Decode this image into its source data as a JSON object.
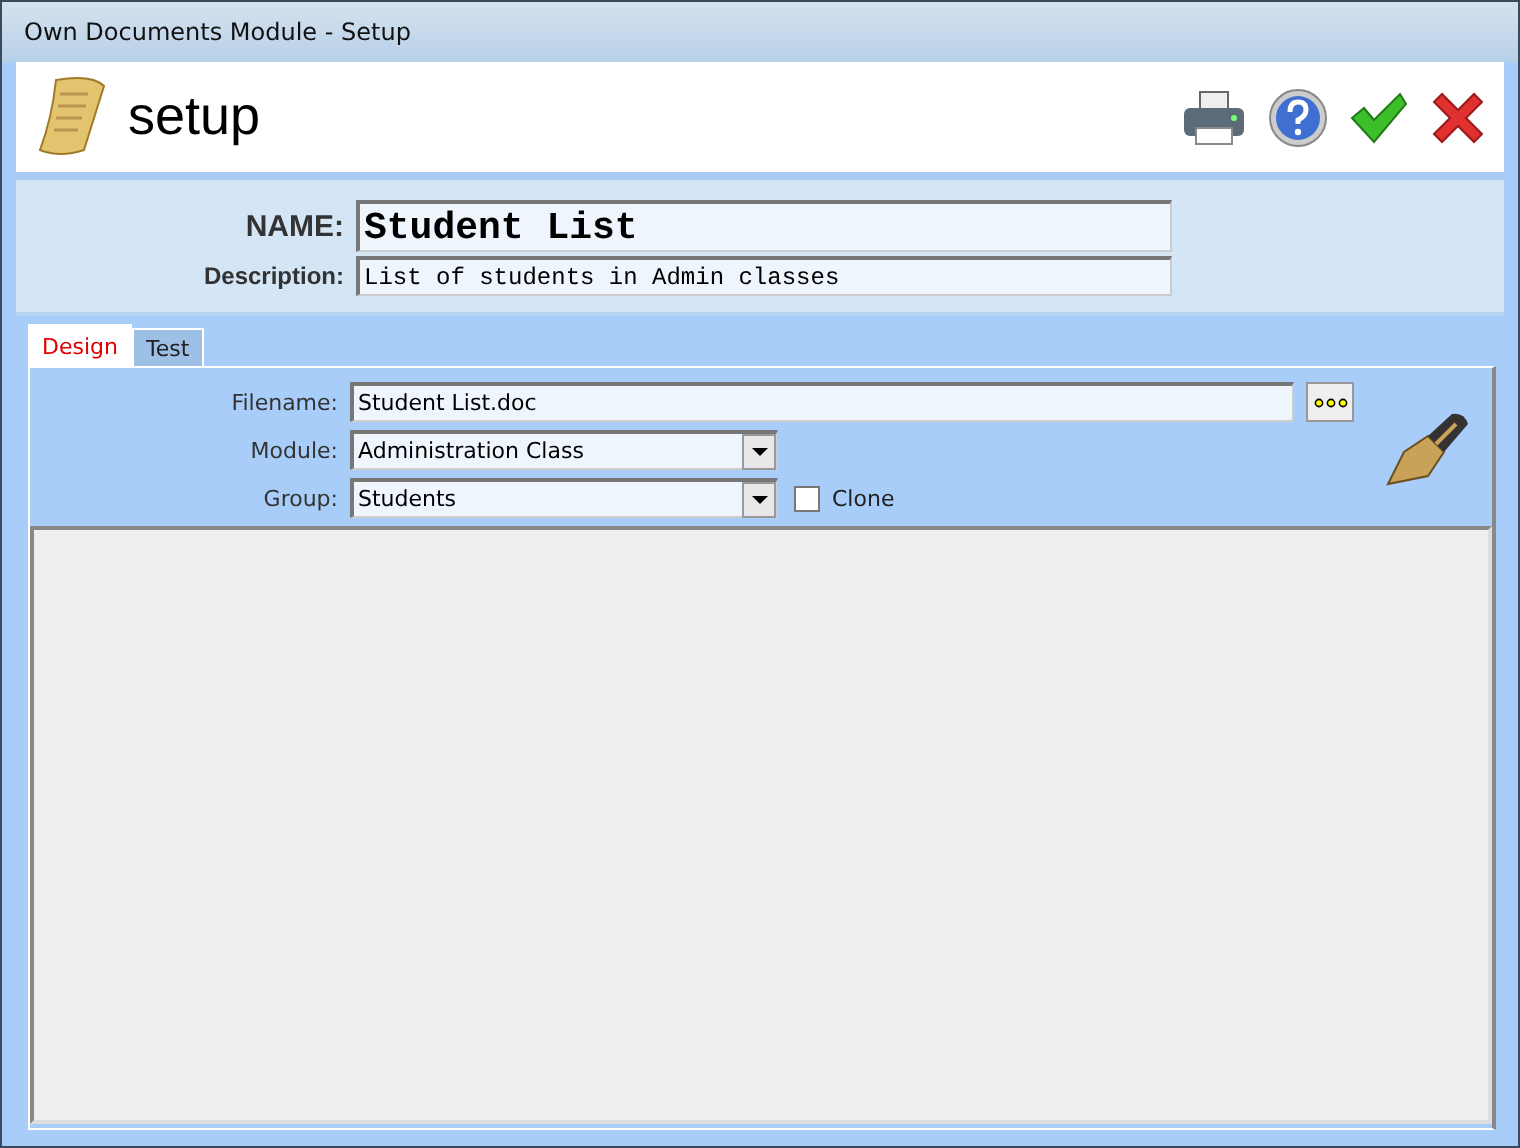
{
  "window": {
    "title": "Own Documents Module - Setup"
  },
  "header": {
    "title": "setup"
  },
  "name_field": {
    "label": "NAME:",
    "value": "Student List"
  },
  "description_field": {
    "label": "Description:",
    "value": "List of students in Admin classes"
  },
  "tabs": [
    {
      "label": "Design",
      "selected": true
    },
    {
      "label": "Test",
      "selected": false
    }
  ],
  "filename_field": {
    "label": "Filename:",
    "value": "Student List.doc"
  },
  "module_field": {
    "label": "Module:",
    "value": "Administration Class"
  },
  "group_field": {
    "label": "Group:",
    "value": "Students"
  },
  "clone": {
    "label": "Clone",
    "checked": false
  }
}
